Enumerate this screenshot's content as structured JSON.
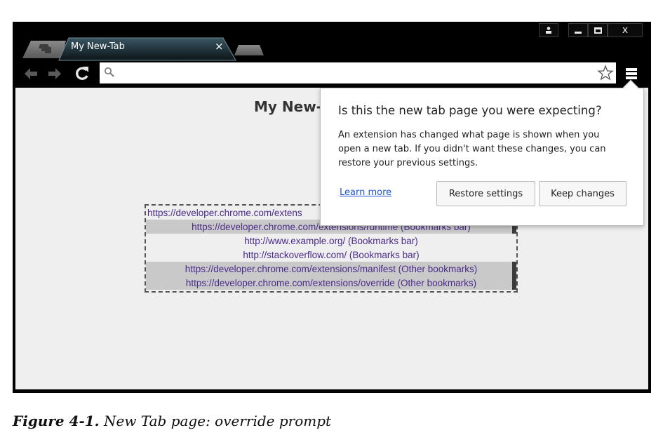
{
  "browser": {
    "tab": {
      "title": "My New-Tab",
      "close_glyph": "×"
    },
    "window_controls": {
      "close_glyph": "x"
    },
    "omnibox": {
      "value": "",
      "search_icon": "search-icon",
      "star_icon": "star-icon"
    },
    "toolbar_icons": [
      "back-arrow-icon",
      "forward-arrow-icon",
      "reload-icon",
      "menu-icon"
    ]
  },
  "page": {
    "title": "My New-",
    "bookmarks": [
      {
        "text": "https://developer.chrome.com/extens",
        "style": "plain-first"
      },
      {
        "text": "https://developer.chrome.com/extensions/runtime (Bookmarks bar)",
        "style": "gray"
      },
      {
        "text": "http://www.example.org/ (Bookmarks bar)",
        "style": "plain"
      },
      {
        "text": "http://stackoverflow.com/ (Bookmarks bar)",
        "style": "plain"
      },
      {
        "text": "https://developer.chrome.com/extensions/manifest (Other bookmarks)",
        "style": "gray"
      },
      {
        "text": "https://developer.chrome.com/extensions/override (Other bookmarks)",
        "style": "gray"
      }
    ]
  },
  "popup": {
    "title": "Is this the new tab page you were expecting?",
    "body_lines": [
      "An extension has changed what page is shown when you",
      "open a new tab. If you didn't want these changes, you can",
      "restore your previous settings."
    ],
    "learn_more": "Learn more",
    "restore_button": "Restore settings",
    "keep_button": "Keep changes"
  },
  "caption": {
    "number": "Figure 4-1.",
    "text": "New Tab page: override prompt"
  },
  "colors": {
    "frame": "#000000",
    "content_bg": "#efefef",
    "link_text": "#4a2b8a",
    "learn_more": "#2255cc",
    "gray_row": "#c9c9c9"
  }
}
